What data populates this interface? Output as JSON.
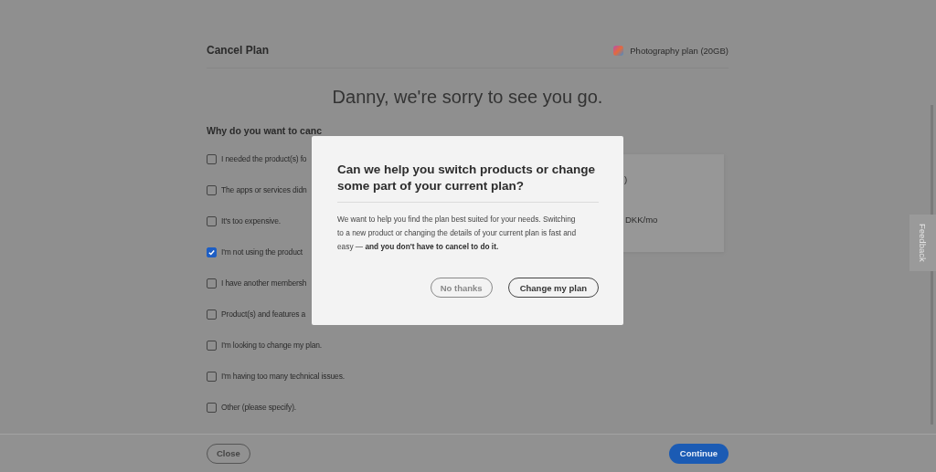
{
  "header": {
    "title": "Cancel Plan",
    "plan": "Photography plan (20GB)"
  },
  "heading": "Danny, we're sorry to see you go.",
  "question": "Why do you want to canc",
  "reasons": [
    {
      "label": "I needed the product(s) fo",
      "checked": false
    },
    {
      "label": "The apps or services didn",
      "checked": false
    },
    {
      "label": "It's too expensive.",
      "checked": false
    },
    {
      "label": "I'm not using the product",
      "checked": true
    },
    {
      "label": "I have another membersh",
      "checked": false
    },
    {
      "label": "Product(s) and features a",
      "checked": false
    },
    {
      "label": "I'm looking to change my plan.",
      "checked": false
    },
    {
      "label": "I'm having too many technical issues.",
      "checked": false
    },
    {
      "label": "Other (please specify).",
      "checked": false
    }
  ],
  "card": {
    "line_1": ")",
    "line_2": "DKK/mo"
  },
  "dialog": {
    "title": "Can we help you switch products or change some part of your current plan?",
    "body": "We want to help you find the plan best suited for your needs. Switching to a new product or changing the details of your current plan is fast and easy — **and you don't have to cancel to do it.**",
    "buttons": [
      {
        "label": "No thanks",
        "kind": "secondary"
      },
      {
        "label": "Change my plan",
        "kind": "primary"
      }
    ]
  },
  "footer": {
    "buttons": [
      {
        "label": "Close",
        "kind": "secondary"
      },
      {
        "label": "Continue",
        "kind": "primary"
      }
    ]
  },
  "feedback": "Feedback"
}
